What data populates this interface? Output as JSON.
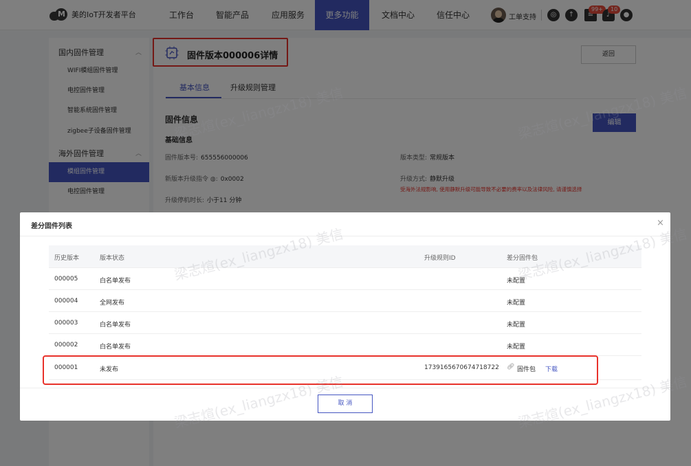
{
  "app": {
    "logo_text": "美的IoT开发者平台"
  },
  "nav": {
    "items": [
      "工作台",
      "智能产品",
      "应用服务",
      "更多功能",
      "文档中心",
      "信任中心"
    ],
    "active": "更多功能",
    "ticket_label": "工单支持",
    "badges": [
      "99+",
      "10"
    ]
  },
  "sidebar": {
    "groups": [
      {
        "label": "国内固件管理",
        "items": [
          "WIFI模组固件管理",
          "电控固件管理",
          "智能系统固件管理",
          "zigbee子设备固件管理"
        ]
      },
      {
        "label": "海外固件管理",
        "items": [
          "模组固件管理",
          "电控固件管理"
        ]
      }
    ],
    "active_item": "模组固件管理"
  },
  "page": {
    "title": "固件版本000006详情",
    "back_label": "返回",
    "tabs": [
      "基本信息",
      "升级规则管理"
    ],
    "active_tab": "基本信息",
    "section_title": "固件信息",
    "edit_label": "编辑",
    "subsection_title": "基础信息",
    "fields": {
      "version_no": {
        "label": "固件版本号:",
        "value": "655556000006"
      },
      "version_type": {
        "label": "版本类型:",
        "value": "常规版本"
      },
      "upgrade_cmd": {
        "label": "新版本升级指令 ◍:",
        "value": "0x0002"
      },
      "upgrade_mode": {
        "label": "升级方式:",
        "value": "静默升级"
      },
      "downtime": {
        "label": "升级停机时长:",
        "value": "小于11 分钟"
      }
    },
    "warning": "受海外法规影响, 使用静默升级可能导致不必要的费率以及法律风险, 请谨慎选择"
  },
  "dialog": {
    "title": "差分固件列表",
    "close_icon": "close-icon",
    "columns": [
      "历史版本",
      "版本状态",
      "升级规则ID",
      "差分固件包"
    ],
    "rows": [
      {
        "version": "000005",
        "status": "白名单发布",
        "rule_id": "",
        "package": "未配置"
      },
      {
        "version": "000004",
        "status": "全网发布",
        "rule_id": "",
        "package": "未配置"
      },
      {
        "version": "000003",
        "status": "白名单发布",
        "rule_id": "",
        "package": "未配置"
      },
      {
        "version": "000002",
        "status": "白名单发布",
        "rule_id": "",
        "package": "未配置"
      },
      {
        "version": "000001",
        "status": "未发布",
        "rule_id": "1739165670674718722",
        "package": "固件包",
        "download": "下载"
      }
    ],
    "cancel_label": "取 消"
  },
  "watermark": "梁志煊(ex_liangzx18) 美信",
  "colors": {
    "primary": "#4455c1",
    "highlight": "#e8312a",
    "warning": "#e8312a"
  }
}
